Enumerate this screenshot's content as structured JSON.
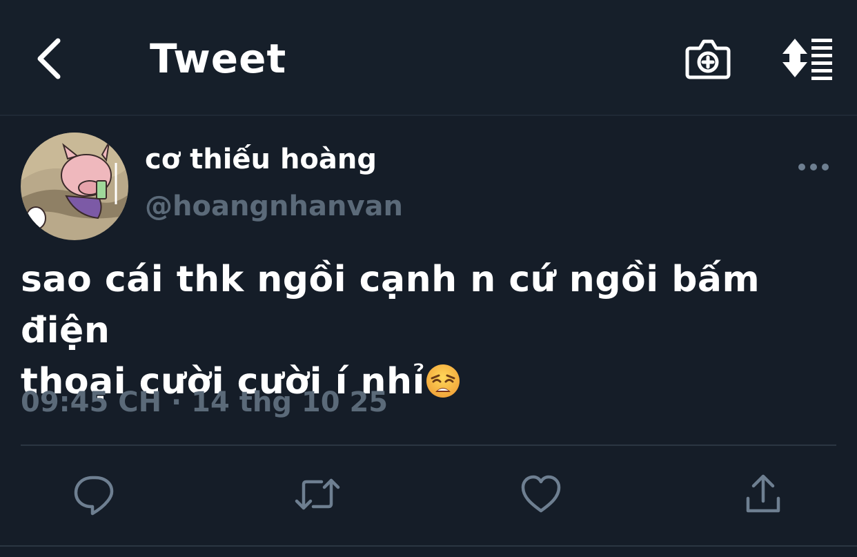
{
  "header": {
    "title": "Tweet",
    "back_icon": "chevron-left-icon",
    "camera_icon": "camera-plus-icon",
    "sort_icon": "sort-list-icon"
  },
  "tweet": {
    "display_name": "cơ thiếu hoàng",
    "handle": "@hoangnhanvan",
    "text_line1": "sao cái thk ngồi cạnh n cứ ngồi bấm điện",
    "text_line2": "thoại cười cười í nhỉ",
    "emoji": "weary-face-emoji",
    "timestamp": "09:45 CH · 14 thg 10 25",
    "more_icon": "more-horizontal-icon"
  },
  "actions": [
    {
      "name": "reply",
      "icon": "comment-icon"
    },
    {
      "name": "retweet",
      "icon": "retweet-icon"
    },
    {
      "name": "like",
      "icon": "heart-icon"
    },
    {
      "name": "share",
      "icon": "share-icon"
    }
  ],
  "colors": {
    "background": "#151d28",
    "text_primary": "#ffffff",
    "text_secondary": "#5b6a79",
    "icon": "#6e7f91",
    "divider": "#2b3642"
  }
}
